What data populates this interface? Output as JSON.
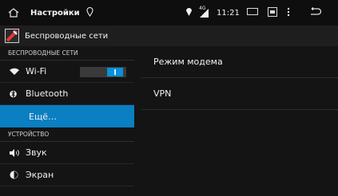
{
  "status_bar": {
    "app_title": "Настройки",
    "network_type": "4G",
    "time": "11:21"
  },
  "title_bar": {
    "icon": "wrench-icon",
    "title": "Беспроводные сети"
  },
  "sidebar": {
    "sections": [
      {
        "header": "БЕСПРОВОДНЫЕ СЕТИ",
        "items": [
          {
            "label": "Wi-Fi",
            "icon": "wifi-icon",
            "toggle": true
          },
          {
            "label": "Bluetooth",
            "icon": "bluetooth-icon"
          },
          {
            "label": "Ещё…",
            "selected": true
          }
        ]
      },
      {
        "header": "УСТРОЙСТВО",
        "items": [
          {
            "label": "Звук",
            "icon": "speaker-icon"
          },
          {
            "label": "Экран",
            "icon": "brightness-icon"
          }
        ]
      }
    ]
  },
  "content": {
    "rows": [
      {
        "label": "Режим модема"
      },
      {
        "label": "VPN"
      }
    ]
  },
  "colors": {
    "accent": "#0a7fc1",
    "background": "#141414",
    "status_bar": "#0e0e0e"
  }
}
